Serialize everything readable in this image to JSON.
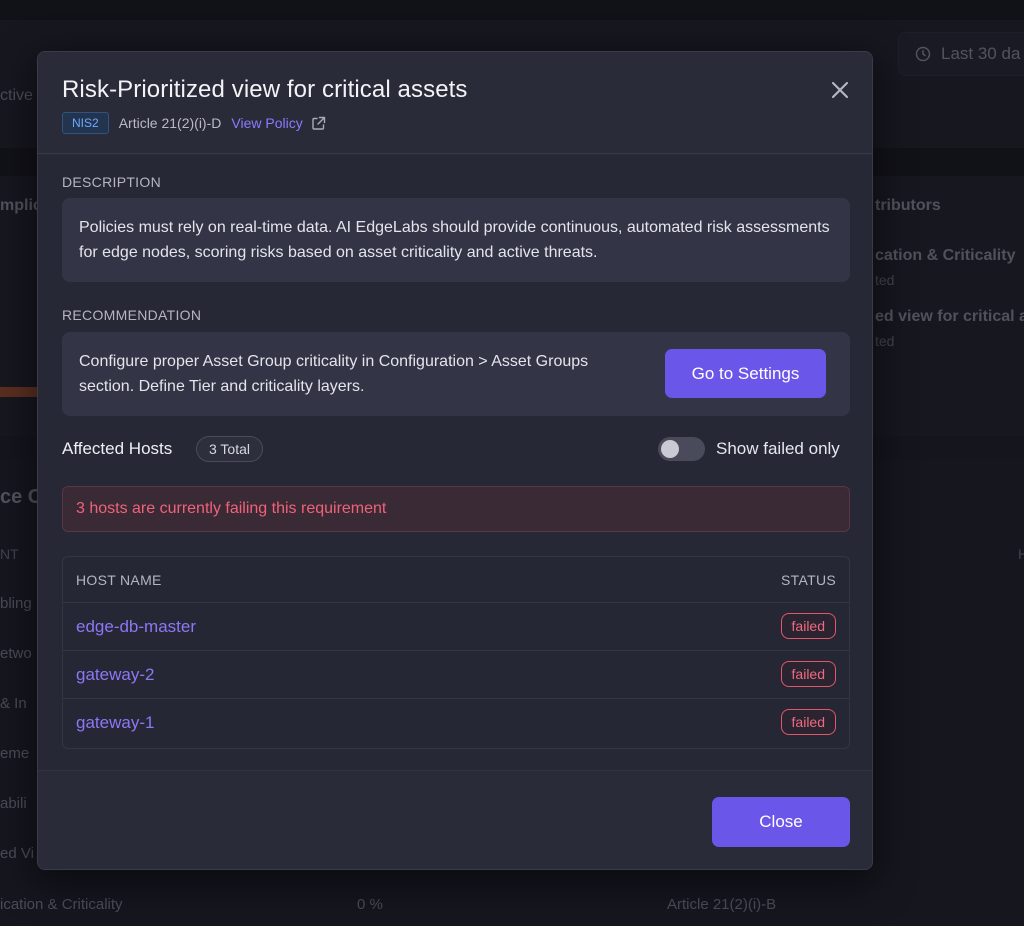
{
  "background": {
    "date_range": "Last 30 da",
    "left_snippets": [
      "ctive",
      "mplic",
      "ce C",
      "NT",
      "bling",
      "etwo",
      "& In",
      "eme",
      "abili",
      "ed Vi",
      "ication & Criticality"
    ],
    "right_card": {
      "title": "tributors",
      "item1_title": "cation & Criticality",
      "item1_sub": "ted",
      "item2_title": "ed view for critical a",
      "item2_sub": "ted"
    },
    "bottom_row": {
      "percent": "0 %",
      "article": "Article 21(2)(i)-B"
    },
    "right_col_header": "H"
  },
  "modal": {
    "title": "Risk-Prioritized view for critical assets",
    "badge": "NIS2",
    "article": "Article 21(2)(i)-D",
    "view_policy": "View Policy",
    "close_icon": "close-icon",
    "description_label": "DESCRIPTION",
    "description_text": "Policies must rely on real-time data. AI EdgeLabs should provide continuous, automated risk assessments for edge nodes, scoring risks based on asset criticality and active threats.",
    "recommendation_label": "RECOMMENDATION",
    "recommendation_text": "Configure proper Asset Group criticality in Configuration > Asset Groups section. Define Tier and criticality layers.",
    "settings_button": "Go to Settings",
    "affected_title": "Affected Hosts",
    "affected_total": "3 Total",
    "toggle_label": "Show failed only",
    "toggle_on": false,
    "alert_text": "3 hosts are currently failing this requirement",
    "table": {
      "col_host": "HOST NAME",
      "col_status": "STATUS",
      "rows": [
        {
          "host": "edge-db-master",
          "status": "failed"
        },
        {
          "host": "gateway-2",
          "status": "failed"
        },
        {
          "host": "gateway-1",
          "status": "failed"
        }
      ]
    },
    "close_button": "Close"
  },
  "colors": {
    "accent": "#6a56e8",
    "link": "#8a78f6",
    "danger": "#ef6a80",
    "badge_blue": "#6fa7ff"
  }
}
